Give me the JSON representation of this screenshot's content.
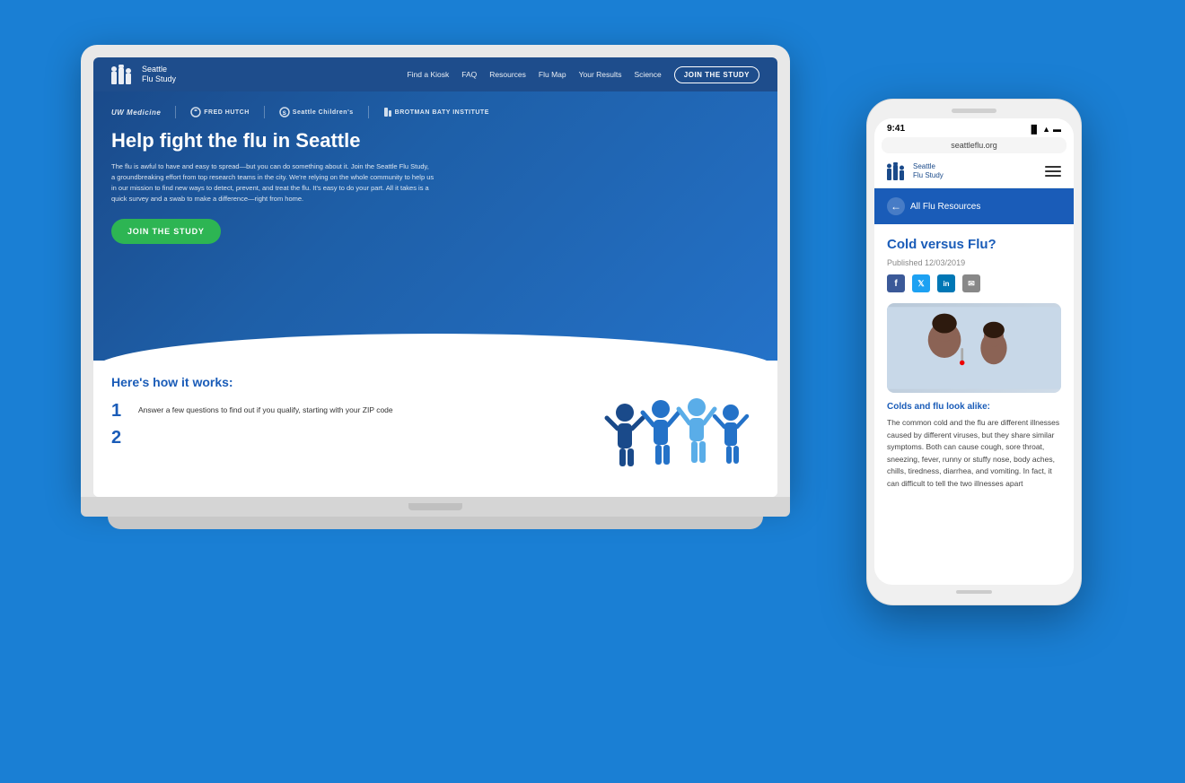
{
  "background_color": "#1a7fd4",
  "laptop": {
    "nav": {
      "logo_name": "Seattle",
      "logo_sub": "Flu Study",
      "links": [
        "Find a Kiosk",
        "FAQ",
        "Resources",
        "Flu Map",
        "Your Results",
        "Science"
      ],
      "cta": "JOIN THE STUDY"
    },
    "hero": {
      "partners": [
        "UW Medicine",
        "FRED HUTCH",
        "Seattle Children's",
        "BROTMAN BATY INSTITUTE"
      ],
      "title": "Help fight the flu in Seattle",
      "description": "The flu is awful to have and easy to spread—but you can do something about it. Join the Seattle Flu Study, a groundbreaking effort from top research teams in the city. We're relying on the whole community to help us in our mission to find new ways to detect, prevent, and treat the flu. It's easy to do your part. All it takes is a quick survey and a swab to make a difference—right from home.",
      "cta_button": "JOIN THE STUDY"
    },
    "how_it_works": {
      "title": "Here's how it works:",
      "steps": [
        {
          "num": "1",
          "text": "Answer a few questions to find out if you qualify, starting with your ZIP code"
        },
        {
          "num": "2",
          "text": ""
        }
      ]
    }
  },
  "phone": {
    "status_bar": {
      "time": "9:41",
      "url": "seattleflu.org"
    },
    "logo_name": "Seattle",
    "logo_sub": "Flu Study",
    "back_label": "All Flu Resources",
    "article": {
      "title": "Cold versus Flu?",
      "date": "Published 12/03/2019",
      "subtitle": "Colds and flu look alike:",
      "body": "The common cold and the flu are different illnesses caused by different viruses, but they share similar symptoms. Both can cause cough, sore throat, sneezing, fever, runny or stuffy nose, body aches, chills, tiredness, diarrhea, and vomiting. In fact, it can difficult to tell the two illnesses apart"
    }
  }
}
